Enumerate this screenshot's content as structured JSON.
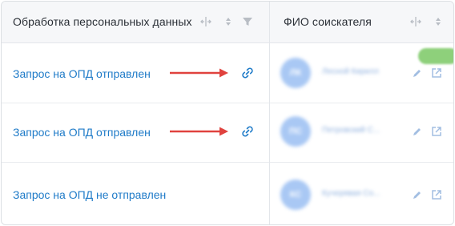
{
  "header": {
    "col1_title": "Обработка персональных данных",
    "col2_title": "ФИО соискателя"
  },
  "rows": [
    {
      "status": "Запрос на ОПД отправлен",
      "has_link": true,
      "candidate": {
        "initials": "ЛК",
        "name": "Лесной Кирилл"
      }
    },
    {
      "status": "Запрос на ОПД отправлен",
      "has_link": true,
      "candidate": {
        "initials": "ПС",
        "name": "Петровский С..."
      }
    },
    {
      "status": "Запрос на ОПД не отправлен",
      "has_link": false,
      "candidate": {
        "initials": "КС",
        "name": "Кучерявая Со..."
      }
    }
  ],
  "colors": {
    "link_text": "#1f7bc8",
    "arrow": "#e0423e",
    "badge": "#8ed07b",
    "avatar": "#a9c8f4"
  },
  "icons": {
    "resize": "resize-horizontal-icon",
    "sort": "sort-icon",
    "filter": "filter-icon",
    "link": "link-icon",
    "edit": "pencil-icon",
    "open": "external-link-icon"
  }
}
